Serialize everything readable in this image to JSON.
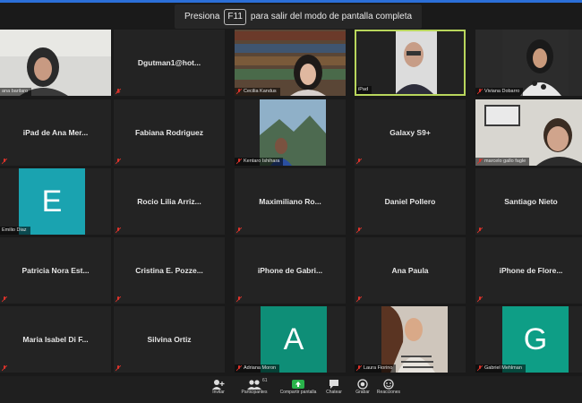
{
  "banner": {
    "prefix": "Presiona",
    "key": "F11",
    "suffix": "para salir del modo de pantalla completa"
  },
  "tiles": [
    {
      "label": "ana barilaro"
    },
    {
      "name": "Dgutman1@hot..."
    },
    {
      "label": "Cecilia Kandus"
    },
    {
      "label": "iPad"
    },
    {
      "label": "Viviana Dobarro"
    },
    {
      "name": "iPad de Ana Mer..."
    },
    {
      "name": "Fabiana Rodriguez"
    },
    {
      "label": "Kentaro Ishihara"
    },
    {
      "name": "Galaxy S9+"
    },
    {
      "label": "marcelo gallo fagle"
    },
    {
      "label": "Emilio Diaz",
      "avatar_letter": "E",
      "avatar_color": "#1aa3b0"
    },
    {
      "name": "Rocio Lilia Arriz..."
    },
    {
      "name": "Maximiliano  Ro..."
    },
    {
      "name": "Daniel Pollero"
    },
    {
      "name": "Santiago Nieto"
    },
    {
      "name": "Patricia Nora Est..."
    },
    {
      "name": "Cristina E. Pozze..."
    },
    {
      "name": "iPhone de Gabri..."
    },
    {
      "name": "Ana Paula"
    },
    {
      "name": "iPhone de Flore..."
    },
    {
      "name": "Maria Isabel Di F..."
    },
    {
      "name": "Silvina Ortiz"
    },
    {
      "label": "Adriana Moron",
      "avatar_letter": "A",
      "avatar_color": "#0e8e77"
    },
    {
      "label": "Laura Fiorino"
    },
    {
      "label": "Gabriel Mehlman",
      "avatar_letter": "G",
      "avatar_color": "#0e9e86"
    }
  ],
  "toolbar": {
    "invite": "Invitar",
    "participants": "Participantes",
    "participants_count": "61",
    "share": "Compartir pantalla",
    "chat": "Chatear",
    "record": "Grabar",
    "reactions": "Reacciones"
  },
  "colors": {
    "accent_border": "#b9d65c",
    "share_green": "#29b34a",
    "muted_red": "#e0332b"
  }
}
